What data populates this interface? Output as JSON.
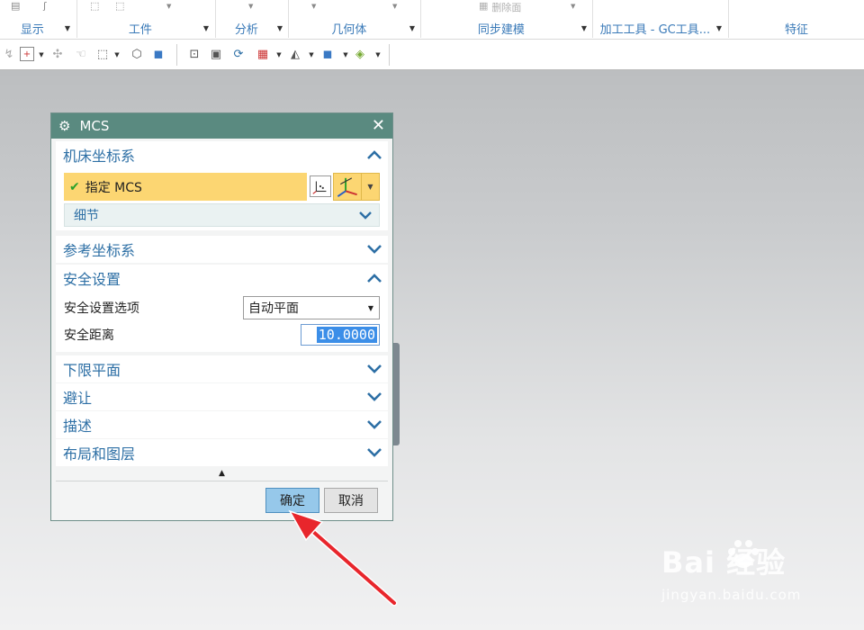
{
  "ribbon": {
    "groups": [
      {
        "label": "显示"
      },
      {
        "label": "工件"
      },
      {
        "label": "分析"
      },
      {
        "label": "几何体"
      },
      {
        "label": "同步建模"
      },
      {
        "label": "加工工具 - GC工具..."
      },
      {
        "label": "特征"
      }
    ],
    "greyed_item": "删除面"
  },
  "dialog": {
    "title": "MCS",
    "sections": {
      "machine_csys": {
        "title": "机床坐标系",
        "specify_label": "指定 MCS",
        "details_label": "细节"
      },
      "ref_csys": {
        "title": "参考坐标系"
      },
      "clearance": {
        "title": "安全设置",
        "option_label": "安全设置选项",
        "option_value": "自动平面",
        "distance_label": "安全距离",
        "distance_value": "10.0000"
      },
      "lower_plane": {
        "title": "下限平面"
      },
      "avoidance": {
        "title": "避让"
      },
      "description": {
        "title": "描述"
      },
      "layout_layers": {
        "title": "布局和图层"
      }
    },
    "ok_label": "确定",
    "cancel_label": "取消"
  },
  "watermark": {
    "logo_text": "Bai  经验",
    "url": "jingyan.baidu.com"
  },
  "colors": {
    "title_bar": "#5a8a80",
    "section_heading": "#2d6fa5",
    "highlight": "#fcd672",
    "ok_button": "#96c8ea",
    "annotation_arrow": "#e8262c"
  }
}
